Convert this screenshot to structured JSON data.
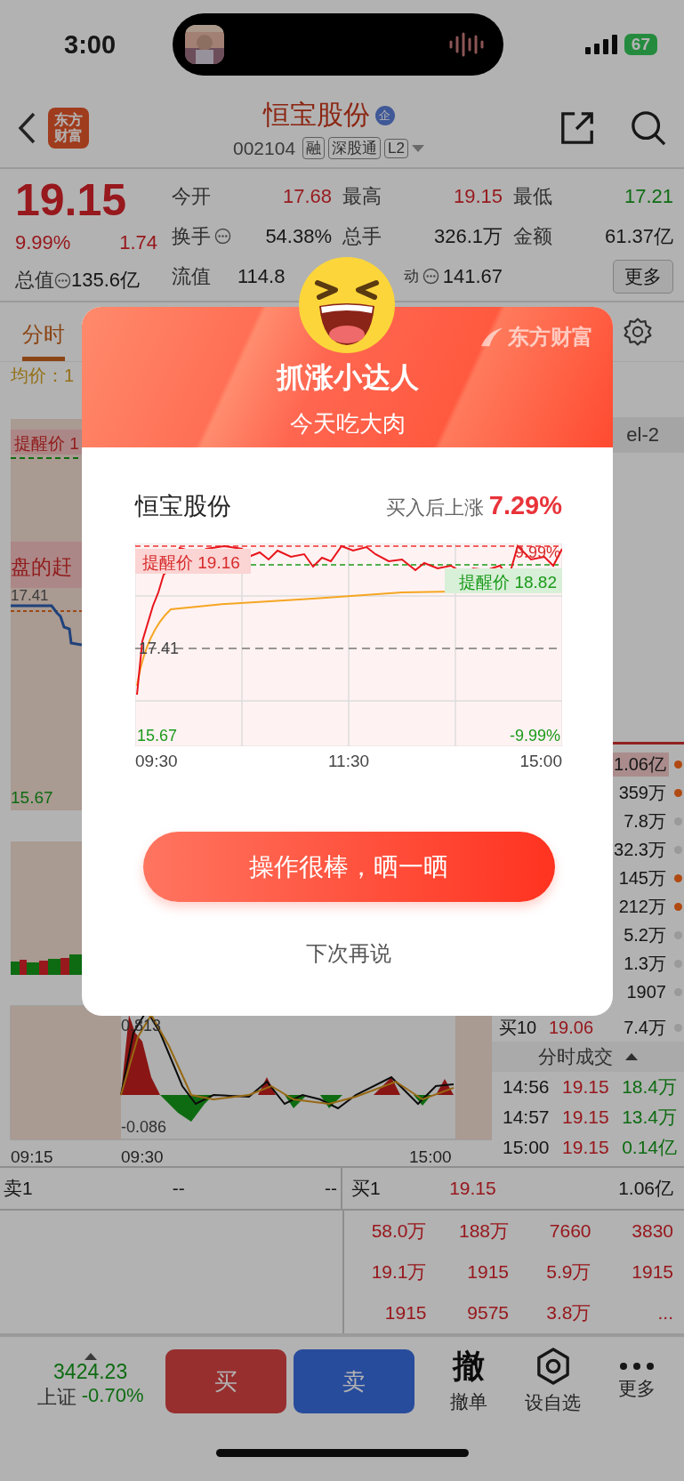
{
  "status_bar": {
    "time": "3:00",
    "battery": "67"
  },
  "header": {
    "logo_lines": [
      "东方",
      "财富"
    ],
    "title": "恒宝股份",
    "badge": "企",
    "code": "002104",
    "tags": [
      "融",
      "深股通",
      "L2"
    ]
  },
  "quote": {
    "price": "19.15",
    "change_pct": "9.99%",
    "change": "1.74",
    "total_label": "总值",
    "total_value": "135.6亿",
    "stats": [
      {
        "label": "今开",
        "value": "17.68",
        "color": "#97191d"
      },
      {
        "label": "最高",
        "value": "19.15",
        "color": "#97191d"
      },
      {
        "label": "最低",
        "value": "17.21",
        "color": "#0f6c13"
      },
      {
        "label": "换手",
        "value": "54.38%",
        "color": "#181818",
        "info": true
      },
      {
        "label": "总手",
        "value": "326.1万",
        "color": "#181818"
      },
      {
        "label": "金额",
        "value": "61.37亿",
        "color": "#181818"
      },
      {
        "label": "流值",
        "value": "114.8",
        "color": "#181818"
      },
      {
        "label": "动",
        "value": "141.67",
        "color": "#181818",
        "info": true
      }
    ],
    "more_button": "更多"
  },
  "tabs": [
    {
      "label": "分时",
      "selected": true
    }
  ],
  "avg_label": "均价：1",
  "left_chart": {
    "alert": "提醒价 1",
    "banner": "盘的赶",
    "mid": "17.41",
    "low": "15.67",
    "macd_high": "0.813",
    "macd_low": "-0.086",
    "times": [
      "09:15",
      "09:30",
      "15:00"
    ]
  },
  "right_panel": {
    "band": "el-2",
    "depth": [
      {
        "value": "1.06亿",
        "color": "#b04a12",
        "highlight": true
      },
      {
        "value": "359万",
        "color": "#b04a12",
        "highlight": false
      },
      {
        "value": "7.8万",
        "color": "#9a9a9a",
        "highlight": false
      },
      {
        "value": "32.3万",
        "color": "#9a9a9a",
        "highlight": false
      },
      {
        "value": "145万",
        "color": "#b04a12",
        "highlight": false
      },
      {
        "value": "212万",
        "color": "#b04a12",
        "highlight": false
      },
      {
        "value": "5.2万",
        "color": "#9a9a9a",
        "highlight": false
      },
      {
        "value": "1.3万",
        "color": "#9a9a9a",
        "highlight": false
      },
      {
        "value": "1907",
        "color": "#9a9a9a",
        "highlight": false
      }
    ],
    "buy10": {
      "label": "买10",
      "price": "19.06",
      "volume": "7.4万",
      "color": "#9a9a9a"
    },
    "trades_title": "分时成交",
    "trades": [
      {
        "time": "14:56",
        "price": "19.15",
        "volume": "18.4万"
      },
      {
        "time": "14:57",
        "price": "19.15",
        "volume": "13.4万"
      },
      {
        "time": "15:00",
        "price": "19.15",
        "volume": "0.14亿"
      }
    ]
  },
  "order_book": {
    "sell1": {
      "label": "卖1",
      "price": "--",
      "volume": "--"
    },
    "buy1": {
      "label": "买1",
      "price": "19.15",
      "volume": "1.06亿"
    },
    "queue": [
      [
        "58.0万",
        "188万",
        "7660",
        "3830"
      ],
      [
        "19.1万",
        "1915",
        "5.9万",
        "1915"
      ],
      [
        "1915",
        "9575",
        "3.8万",
        "..."
      ]
    ]
  },
  "bottom_bar": {
    "index_value": "3424.23",
    "index_name": "上证",
    "index_change": "-0.70%",
    "buy": "买",
    "sell": "卖",
    "actions": [
      {
        "kind": "cancel",
        "glyph": "撤",
        "label": "撤单"
      },
      {
        "kind": "watch",
        "label": "设自选"
      },
      {
        "kind": "more",
        "label": "更多"
      }
    ]
  },
  "modal": {
    "logo": "东方财富",
    "title": "抓涨小达人",
    "subtitle": "今天吃大肉",
    "stock": "恒宝股份",
    "gain_label": "买入后上涨",
    "gain": "7.29%",
    "chart": {
      "alert_high": "提醒价 19.16",
      "limit_up": "9.99%",
      "alert_low": "提醒价 18.82",
      "mid": "17.41",
      "low": "15.67",
      "limit_down": "-9.99%"
    },
    "times": [
      "09:30",
      "11:30",
      "15:00"
    ],
    "share_button": "操作很棒，晒一晒",
    "dismiss": "下次再说"
  }
}
